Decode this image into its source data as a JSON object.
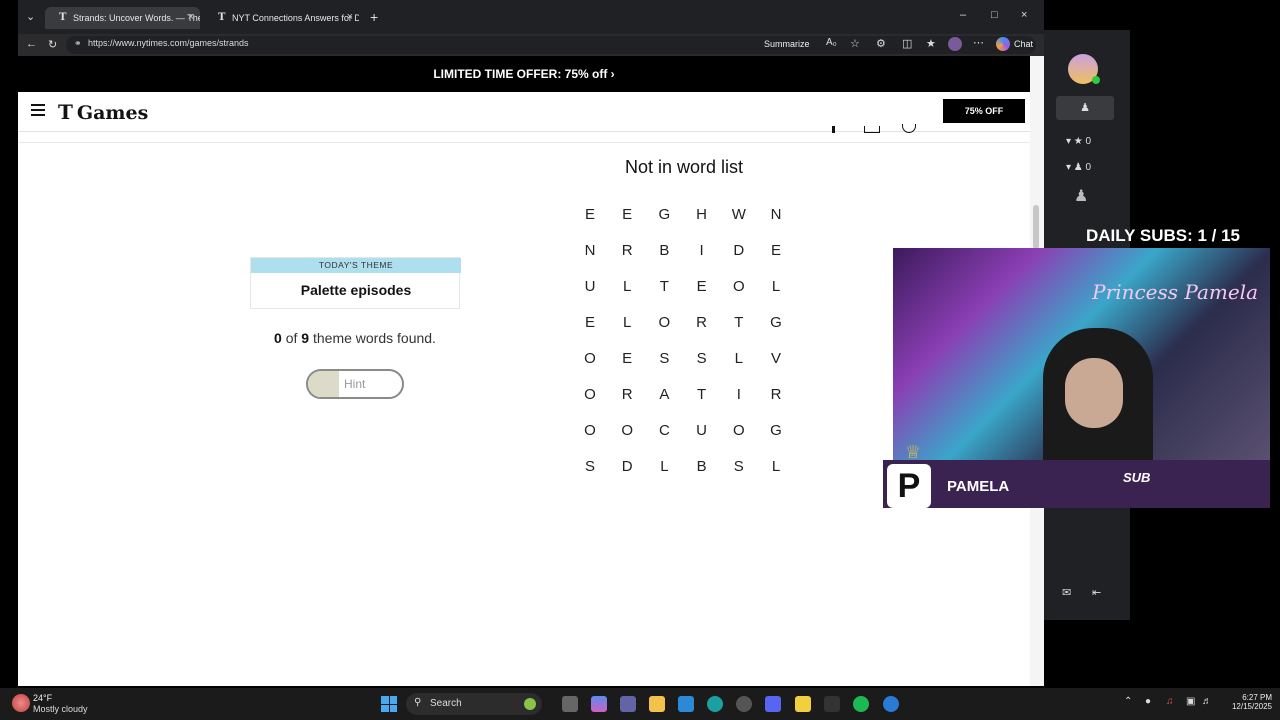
{
  "browser": {
    "tabs": [
      {
        "title": "Strands: Uncover Words. — The N",
        "active": true
      },
      {
        "title": "NYT Connections Answers for Dec",
        "active": false
      }
    ],
    "url": "https://www.nytimes.com/games/strands",
    "summarize_label": "Summarize",
    "chat_label": "Chat"
  },
  "nyt": {
    "promo": "LIMITED TIME OFFER: 75% off ›",
    "logo_text": "Games",
    "offer_button": "75% OFF"
  },
  "strands": {
    "message": "Not in word list",
    "theme_label": "TODAY'S THEME",
    "theme": "Palette episodes",
    "found_count": "0",
    "found_total": "9",
    "found_suffix": "theme words found.",
    "found_of": "of",
    "hint_label": "Hint",
    "hint_progress": 0.33,
    "grid": [
      [
        "E",
        "E",
        "G",
        "H",
        "W",
        "N"
      ],
      [
        "N",
        "R",
        "B",
        "I",
        "D",
        "E"
      ],
      [
        "U",
        "L",
        "T",
        "E",
        "O",
        "L"
      ],
      [
        "E",
        "L",
        "O",
        "R",
        "T",
        "G"
      ],
      [
        "O",
        "E",
        "S",
        "S",
        "L",
        "V"
      ],
      [
        "O",
        "R",
        "A",
        "T",
        "I",
        "R"
      ],
      [
        "O",
        "O",
        "C",
        "U",
        "O",
        "G"
      ],
      [
        "S",
        "D",
        "L",
        "B",
        "S",
        "L"
      ]
    ]
  },
  "side_panel": {
    "likes": "0",
    "members": "0"
  },
  "stream": {
    "daily_subs": "DAILY SUBS:  1 / 15",
    "cam_name": "Princess Pamela",
    "nameplate_name": "PAMELA",
    "nameplate_sub": "SUB"
  },
  "taskbar": {
    "temp": "24°F",
    "weather": "Mostly cloudy",
    "search": "Search",
    "time": "6:27 PM",
    "date": "12/15/2025"
  }
}
